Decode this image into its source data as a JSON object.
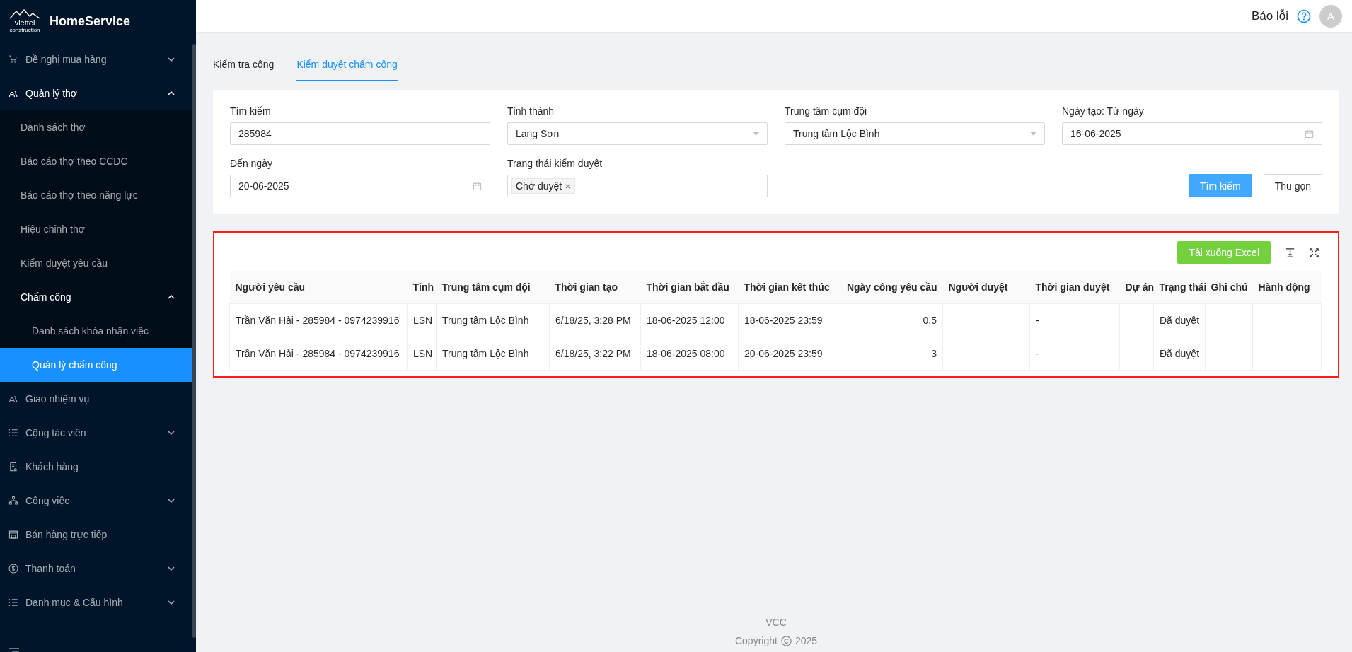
{
  "app": {
    "name": "HomeService",
    "logo_text": "viettel",
    "logo_subtext": "construction"
  },
  "sidebar": {
    "items": [
      {
        "label": "Đề nghị mua hàng",
        "expanded": false,
        "selected": false
      },
      {
        "label": "Quản lý thợ",
        "expanded": true,
        "selected": false,
        "children": [
          {
            "label": "Danh sách thợ",
            "selected": false
          },
          {
            "label": "Báo cáo thợ theo CCDC",
            "selected": false
          },
          {
            "label": "Báo cáo thợ theo năng lực",
            "selected": false
          },
          {
            "label": "Hiệu chỉnh thợ",
            "selected": false
          },
          {
            "label": "Kiểm duyệt yêu cầu",
            "selected": false
          },
          {
            "label": "Chấm công",
            "expanded": true,
            "selected": false,
            "children": [
              {
                "label": "Danh sách khóa nhận việc",
                "selected": false
              },
              {
                "label": "Quản lý chấm công",
                "selected": true
              }
            ]
          }
        ]
      },
      {
        "label": "Giao nhiệm vụ",
        "selected": false
      },
      {
        "label": "Cộng tác viên",
        "expanded": false,
        "selected": false
      },
      {
        "label": "Khách hàng",
        "selected": false
      },
      {
        "label": "Công việc",
        "expanded": false,
        "selected": false
      },
      {
        "label": "Bán hàng trực tiếp",
        "selected": false
      },
      {
        "label": "Thanh toán",
        "expanded": false,
        "selected": false
      },
      {
        "label": "Danh mục & Cấu hình",
        "expanded": false,
        "selected": false
      }
    ]
  },
  "header": {
    "report_link": "Báo lỗi",
    "avatar": "A"
  },
  "tabs": [
    {
      "label": "Kiểm tra công",
      "selected": false
    },
    {
      "label": "Kiểm duyệt chấm công",
      "selected": true
    }
  ],
  "filters": {
    "fields": [
      {
        "kind": "text",
        "label": "Tìm kiếm",
        "value": "285984"
      },
      {
        "kind": "select",
        "label": "Tỉnh thành",
        "value": "Lạng Sơn"
      },
      {
        "kind": "select",
        "label": "Trung tâm cụm đội",
        "value": "Trung tâm Lộc Bình"
      },
      {
        "kind": "date",
        "label": "Ngày tạo: Từ ngày",
        "value": "16-06-2025"
      },
      {
        "kind": "date",
        "label": "Đến ngày",
        "value": "20-06-2025"
      },
      {
        "kind": "tags",
        "label": "Trạng thái kiểm duyệt",
        "tags": [
          "Chờ duyệt"
        ]
      }
    ],
    "buttons": [
      {
        "kind": "primary",
        "label": "Tìm kiếm"
      },
      {
        "kind": "default",
        "label": "Thu gọn"
      }
    ]
  },
  "table": {
    "highlighted": true,
    "export_button": "Tải xuống Excel",
    "columns": [
      {
        "label": "Người yêu cầu",
        "kind": "text"
      },
      {
        "label": "Tỉnh",
        "kind": "text"
      },
      {
        "label": "Trung tâm cụm đội",
        "kind": "text"
      },
      {
        "label": "Thời gian tạo",
        "kind": "text"
      },
      {
        "label": "Thời gian bắt đầu",
        "kind": "text"
      },
      {
        "label": "Thời gian kết thúc",
        "kind": "text"
      },
      {
        "label": "Ngày công yêu cầu",
        "kind": "number"
      },
      {
        "label": "Người duyệt",
        "kind": "text"
      },
      {
        "label": "Thời gian duyệt",
        "kind": "text"
      },
      {
        "label": "Dự án",
        "kind": "text"
      },
      {
        "label": "Trạng thái",
        "kind": "text"
      },
      {
        "label": "Ghi chú",
        "kind": "text"
      },
      {
        "label": "Hành động",
        "kind": "text"
      }
    ],
    "rows": [
      [
        "Trần Văn Hải - 285984 - 0974239916",
        "LSN",
        "Trung tâm Lộc Bình",
        "6/18/25, 3:28 PM",
        "18-06-2025 12:00",
        "18-06-2025 23:59",
        "0.5",
        null,
        "-",
        null,
        "Đã duyệt",
        null,
        null
      ],
      [
        "Trần Văn Hải - 285984 - 0974239916",
        "LSN",
        "Trung tâm Lộc Bình",
        "6/18/25, 3:22 PM",
        "18-06-2025 08:00",
        "20-06-2025 23:59",
        "3",
        null,
        "-",
        null,
        "Đã duyệt",
        null,
        null
      ]
    ]
  },
  "footer": {
    "company": "VCC",
    "copyright": "Copyright",
    "year": "2025"
  }
}
